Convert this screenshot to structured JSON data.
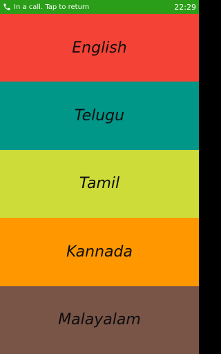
{
  "status_bar": {
    "call_text": "In a call. Tap to return",
    "clock": "22:29",
    "call_icon": "phone-icon",
    "background": "#2a9e18"
  },
  "languages": [
    {
      "label": "English",
      "color": "#f44336"
    },
    {
      "label": "Telugu",
      "color": "#009688"
    },
    {
      "label": "Tamil",
      "color": "#cddc39"
    },
    {
      "label": "Kannada",
      "color": "#ff9800"
    },
    {
      "label": "Malayalam",
      "color": "#795548"
    }
  ]
}
